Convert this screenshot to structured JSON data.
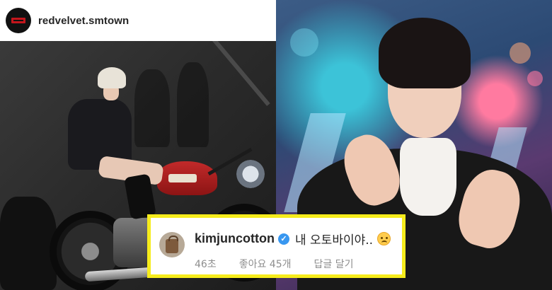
{
  "post": {
    "username": "redvelvet.smtown",
    "avatar_icon": "red-velvet-logo",
    "photo_icon": "person-on-motorcycle-photo"
  },
  "right_photo": {
    "photo_icon": "man-on-stage-photo"
  },
  "comment": {
    "username": "kimjuncotton",
    "verified_icon": "verified-badge-icon",
    "text": "내 오토바이야..",
    "emoji_icon": "worried-face-emoji",
    "meta": {
      "time": "46초",
      "likes": "좋아요 45개",
      "reply": "답글 달기"
    },
    "highlight_color": "#f6ec1c"
  },
  "colors": {
    "verified": "#3897f0",
    "text": "#262626",
    "meta": "#8e8e8e"
  }
}
